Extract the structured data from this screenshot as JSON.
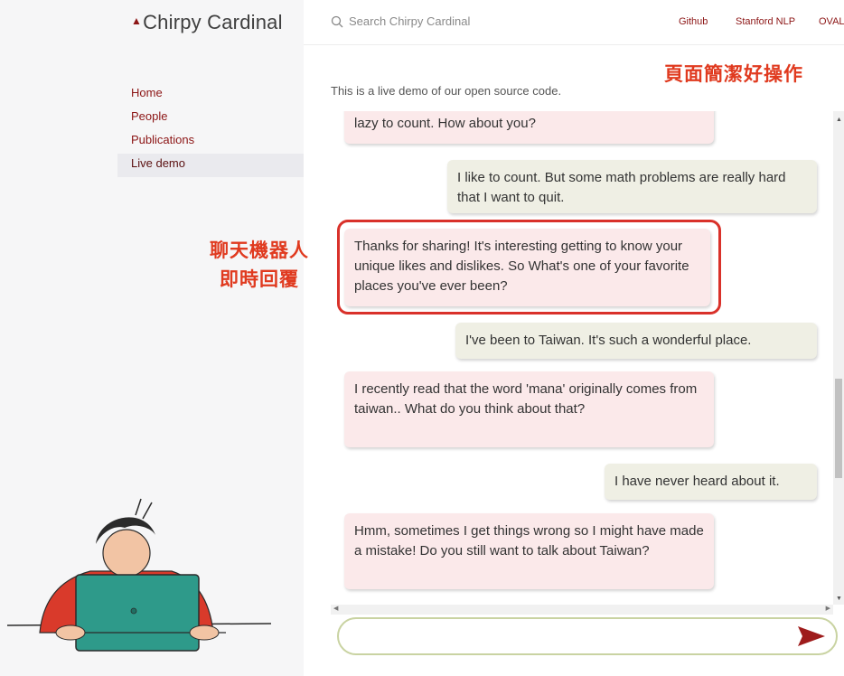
{
  "brand": {
    "name": "Chirpy Cardinal",
    "mark": "▲"
  },
  "nav": {
    "items": [
      {
        "label": "Home"
      },
      {
        "label": "People"
      },
      {
        "label": "Publications"
      },
      {
        "label": "Live demo",
        "active": true
      }
    ]
  },
  "search": {
    "placeholder": "Search Chirpy Cardinal",
    "icon": "search-icon"
  },
  "toplinks": {
    "github": "Github",
    "stanford": "Stanford NLP",
    "oval": "OVAL"
  },
  "intro": "This is a live demo of our open source code.",
  "annotations": {
    "top": "頁面簡潔好操作",
    "left_line1": "聊天機器人",
    "left_line2": "即時回覆"
  },
  "messages": [
    {
      "role": "bot",
      "text": "lazy to count. How about you?"
    },
    {
      "role": "user",
      "text": "I like to count. But some math problems are really hard that I want to quit."
    },
    {
      "role": "bot",
      "text": "Thanks for sharing! It's interesting getting to know your unique likes and dislikes. So What's one of your favorite places you've ever been?",
      "highlighted": true
    },
    {
      "role": "user",
      "text": "I've been to Taiwan. It's such a wonderful place."
    },
    {
      "role": "bot",
      "text": "I recently read that the word 'mana' originally comes from taiwan.. What do you think about that?"
    },
    {
      "role": "user",
      "text": "I have never heard about it."
    },
    {
      "role": "bot",
      "text": "Hmm, sometimes I get things wrong so I might have made a mistake! Do you still want to talk about Taiwan?"
    }
  ],
  "composer": {
    "value": "",
    "send_icon": "send-arrow-icon"
  },
  "colors": {
    "accent": "#8c1515",
    "annotation": "#e03a1f",
    "bot_bubble": "#fbe9ea",
    "user_bubble": "#efefe4",
    "input_border": "#c9d3a2"
  }
}
